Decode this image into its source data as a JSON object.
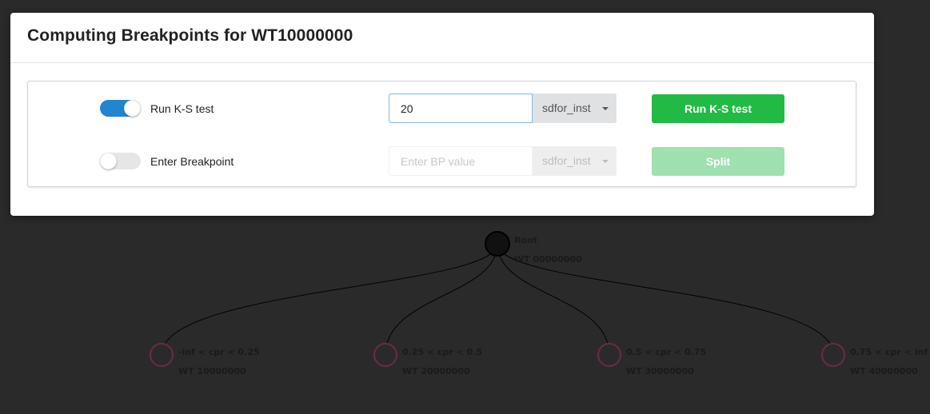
{
  "modal": {
    "title": "Computing Breakpoints for WT10000000"
  },
  "ks_row": {
    "toggle_label": "Run K-S test",
    "toggle_on": true,
    "input_value": "20",
    "dropdown_value": "sdfor_inst",
    "button_label": "Run K-S test"
  },
  "bp_row": {
    "toggle_label": "Enter Breakpoint",
    "toggle_on": false,
    "input_placeholder": "Enter BP value",
    "dropdown_value": "sdfor_inst",
    "button_label": "Split"
  },
  "tree": {
    "root": {
      "name": "Root",
      "id": "WT 00000000"
    },
    "children": [
      {
        "name": "-inf < cpr < 0.25",
        "id": "WT 10000000"
      },
      {
        "name": "0.25 < cpr < 0.5",
        "id": "WT 20000000"
      },
      {
        "name": "0.5 < cpr < 0.75",
        "id": "WT 30000000"
      },
      {
        "name": "0.75 < cpr < inf",
        "id": "WT 40000000"
      }
    ]
  },
  "colors": {
    "toggle_on": "#2185d0",
    "button_green": "#21ba45",
    "child_node_stroke": "#6b2a4a"
  }
}
